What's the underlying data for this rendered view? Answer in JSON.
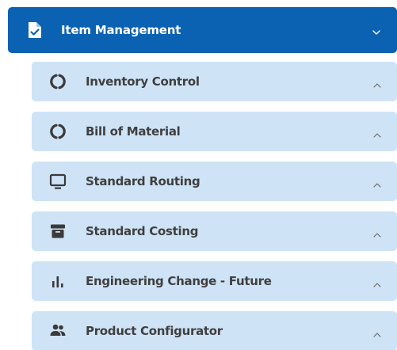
{
  "header": {
    "label": "Item Management",
    "icon": "document-check-icon",
    "chevron": "chevron-down-icon",
    "background": "#0b61b2"
  },
  "submenu": {
    "background": "#cfe3f6",
    "text_color": "#3f3f3f",
    "items": [
      {
        "label": "Inventory Control",
        "icon": "circle-notch-icon",
        "chevron": "chevron-up-icon"
      },
      {
        "label": "Bill of Material",
        "icon": "circle-notch-icon",
        "chevron": "chevron-up-icon"
      },
      {
        "label": "Standard Routing",
        "icon": "monitor-icon",
        "chevron": "chevron-up-icon"
      },
      {
        "label": "Standard Costing",
        "icon": "archive-box-icon",
        "chevron": "chevron-up-icon"
      },
      {
        "label": "Engineering Change - Future",
        "icon": "bar-chart-icon",
        "chevron": "chevron-up-icon"
      },
      {
        "label": "Product Configurator",
        "icon": "people-icon",
        "chevron": "chevron-up-icon"
      }
    ]
  }
}
